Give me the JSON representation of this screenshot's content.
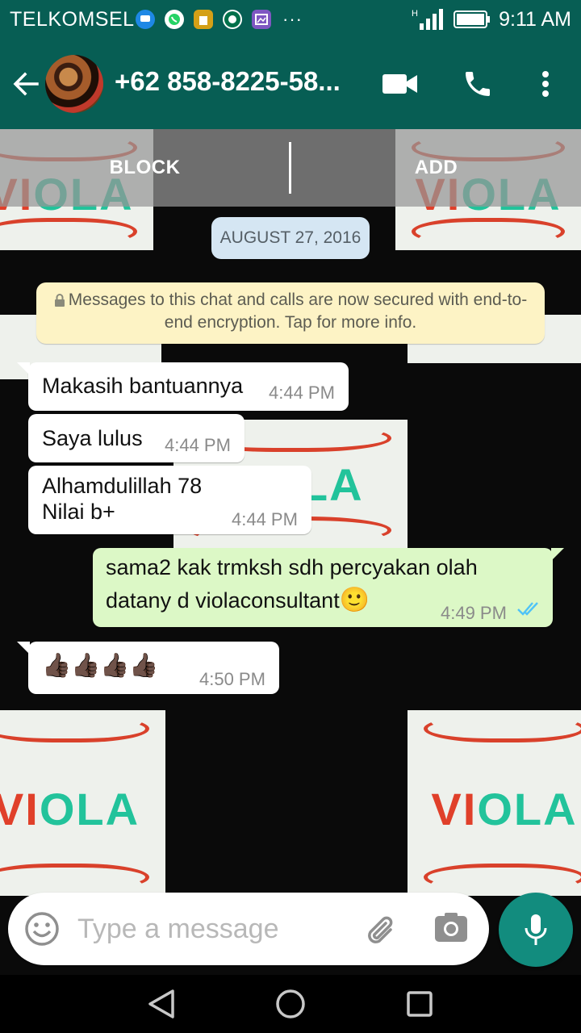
{
  "status_bar": {
    "carrier": "TELKOMSEL",
    "time": "9:11 AM",
    "more": "···"
  },
  "toolbar": {
    "contact_name": "+62 858-8225-58..."
  },
  "actions": {
    "block_label": "BLOCK",
    "add_label": "ADD"
  },
  "chat": {
    "date_label": "AUGUST 27, 2016",
    "encryption_notice": "Messages to this chat and calls are now secured with end-to-end encryption. Tap for more info.",
    "messages": [
      {
        "direction": "in",
        "text": "Makasih bantuannya",
        "time": "4:44 PM"
      },
      {
        "direction": "in",
        "text": "Saya lulus",
        "time": "4:44 PM"
      },
      {
        "direction": "in",
        "line1": "Alhamdulillah 78",
        "line2": "Nilai b+",
        "time": "4:44 PM"
      },
      {
        "direction": "out",
        "line1": "sama2 kak trmksh sdh percyakan olah",
        "line2": "datany d violaconsultant",
        "emoji": "🙂",
        "time": "4:49 PM",
        "status": "read"
      },
      {
        "direction": "in",
        "text": "👍🏿👍🏿👍🏿👍🏿",
        "time": "4:50 PM"
      }
    ]
  },
  "background": {
    "wallpaper_text_a": "VI",
    "wallpaper_text_b": "O",
    "wallpaper_text_c": "LA",
    "accent_red": "#d9412b",
    "accent_teal": "#22c39b"
  },
  "composer": {
    "placeholder": "Type a message",
    "value": ""
  },
  "colors": {
    "header": "#075e54",
    "outgoing_bubble": "#dcf8c6",
    "fab": "#128c7e",
    "read_ticks": "#4fc3f7"
  }
}
